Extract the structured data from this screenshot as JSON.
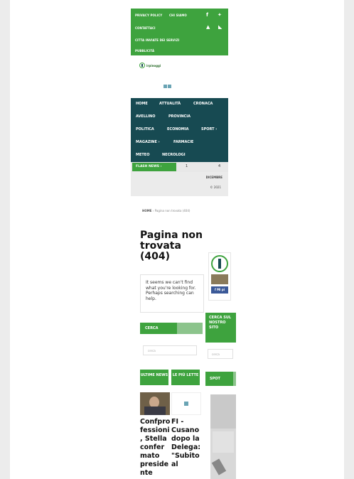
{
  "topbar": {
    "links": [
      "PRIVACY POLICY",
      "CHI SIAMO",
      "CONTATTACI",
      "CITTA INVIATE DEI SERVIZI",
      "PUBBLICITÀ"
    ],
    "social": [
      "f",
      "t",
      "camera",
      "rss"
    ]
  },
  "logo": {
    "text": "irpinoggi"
  },
  "nav": {
    "items": [
      "HOME",
      "ATTUALITÀ",
      "CRONACA",
      "AVELLINO",
      "PROVINCIA",
      "POLITICA",
      "ECONOMIA",
      "SPORT ›",
      "MAGAZINE ›",
      "FARMACIE",
      "METEO",
      "NECROLOGI"
    ]
  },
  "flash": {
    "label": "FLASH NEWS  ›",
    "n1": "1",
    "n2": "4"
  },
  "date": {
    "line1": "DICEMBRE",
    "line2": "© 2021"
  },
  "breadcrumb": {
    "home": "HOME",
    "sep": "›",
    "current": "Pagina non trovata (404)"
  },
  "page": {
    "title": "Pagina non trovata (404)",
    "message": "It seems we can't find what you're looking for. Perhaps searching can help.",
    "cerca_label": "CERCA",
    "search_placeholder": "cerca"
  },
  "tabs": [
    "ULTIME NEWS",
    "LE PIÙ LETTE"
  ],
  "news": [
    {
      "title": "Confpro fessioni , Stella confer mato preside nte"
    },
    {
      "title": "FI - Cusano dopo la Delega: \"Subito al"
    }
  ],
  "sidebar": {
    "fb_label": "f Mi pi",
    "cerca_label": "CERCA SUL NOSTRO SITO",
    "search_placeholder": "cerca",
    "spot_label": "SPOT"
  },
  "colors": {
    "green": "#3ea33e",
    "dark_teal": "#174a52"
  }
}
